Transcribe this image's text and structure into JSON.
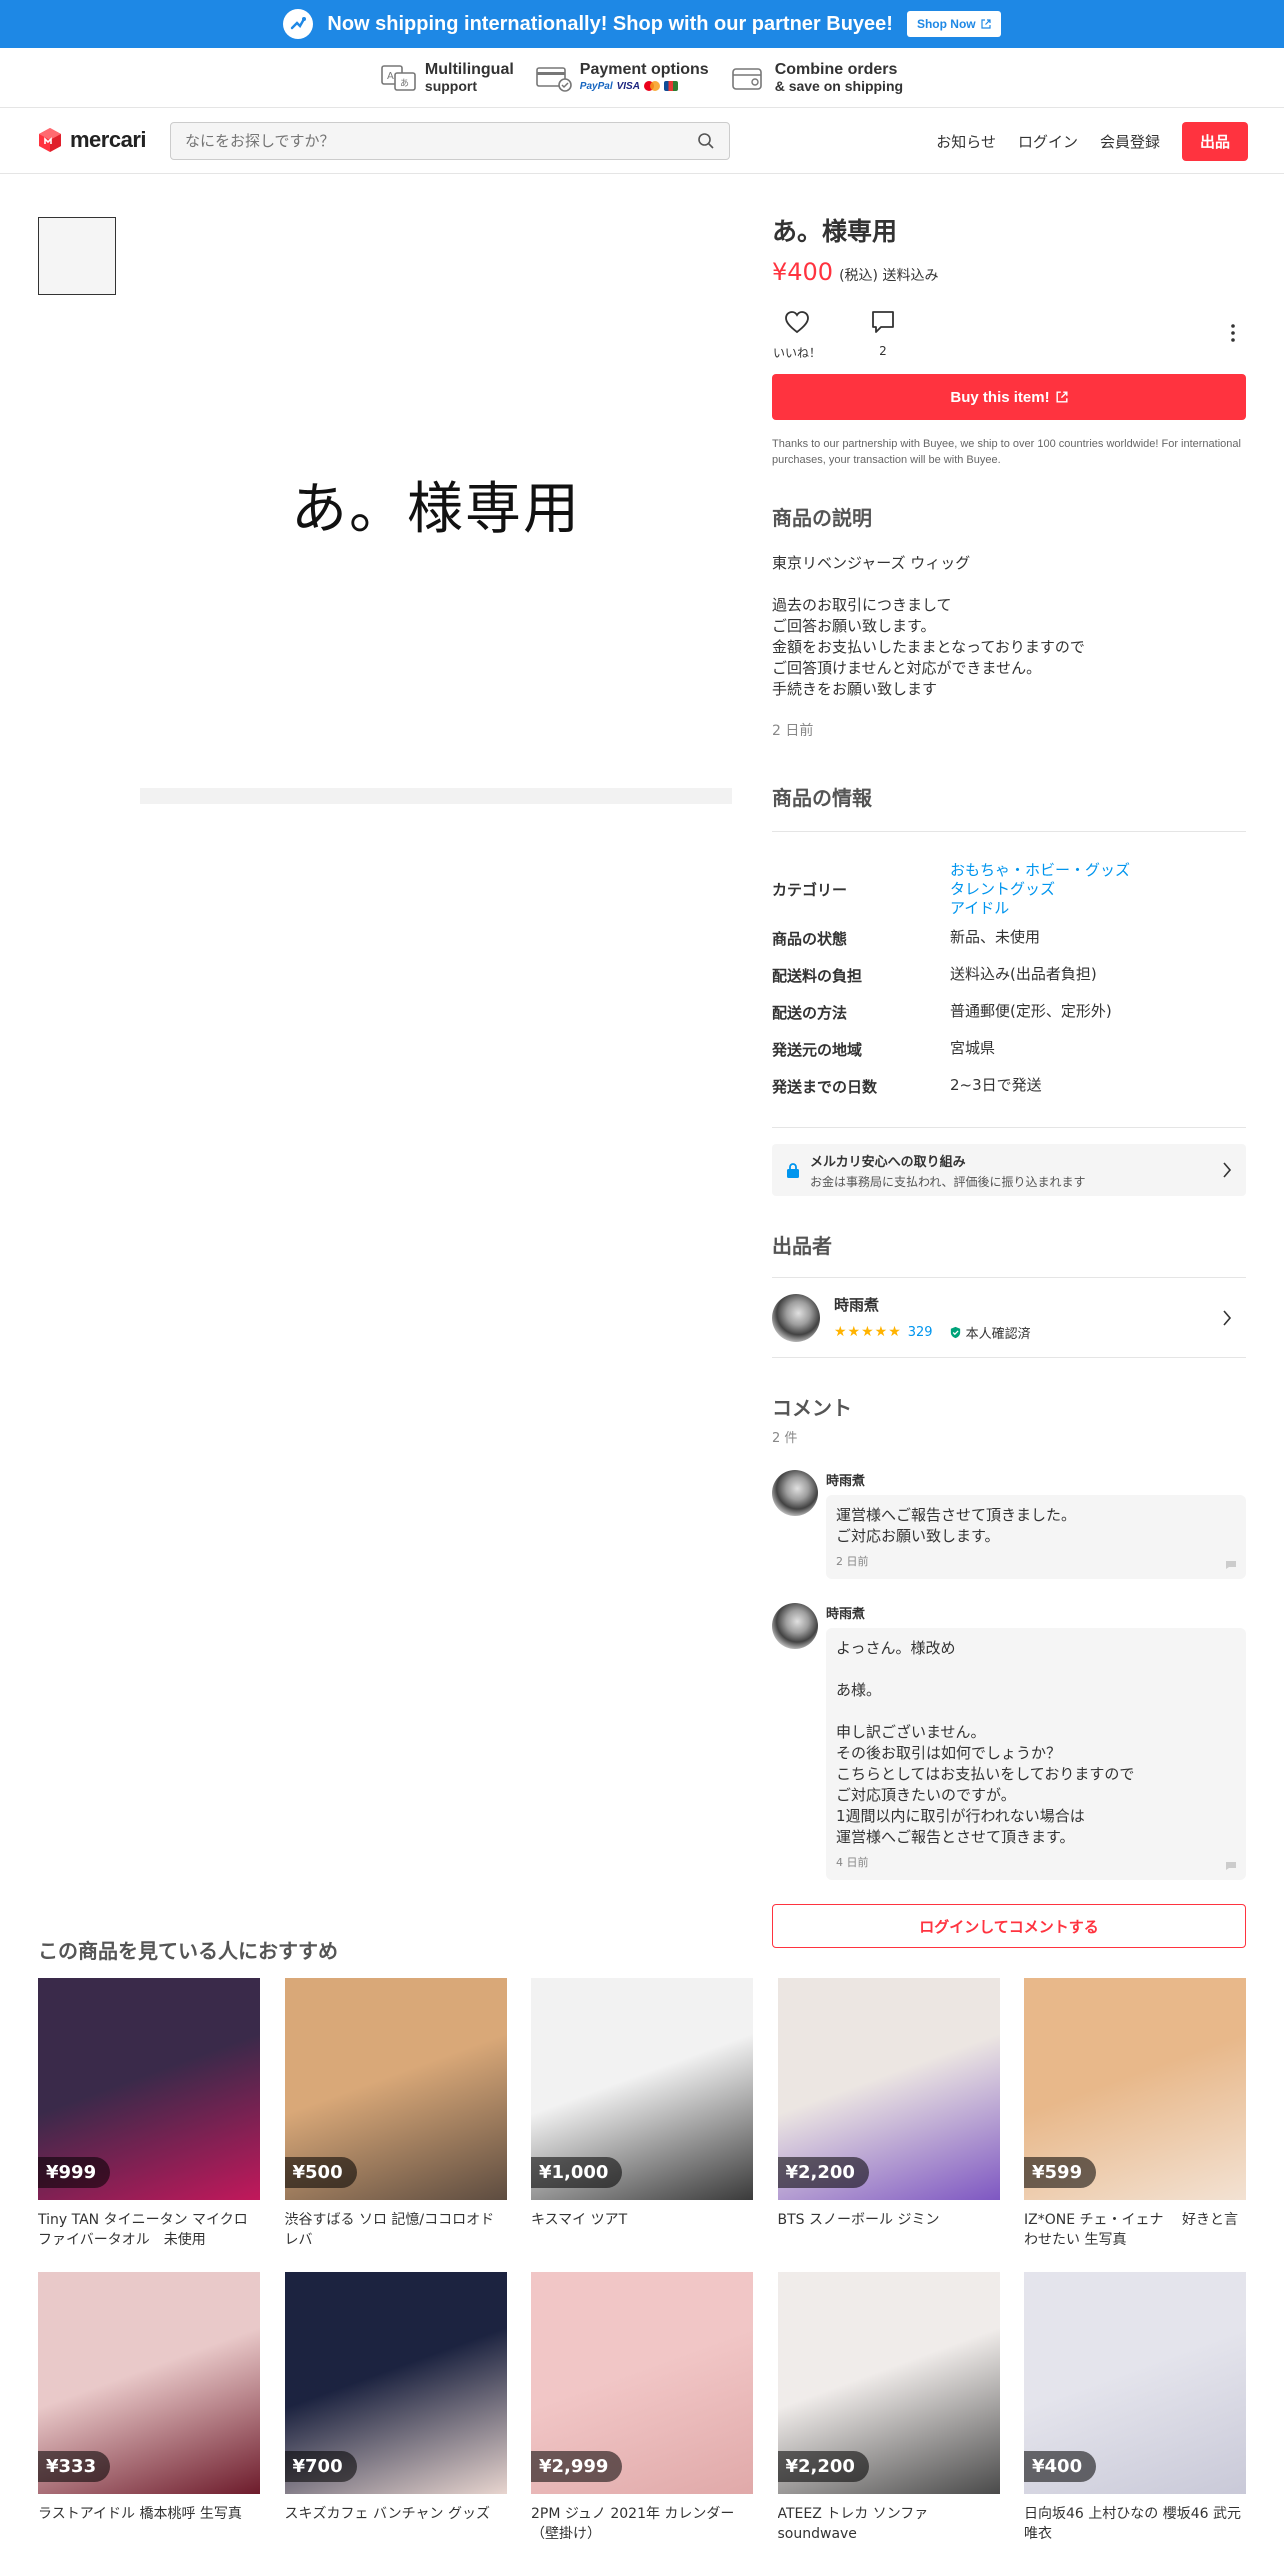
{
  "banner": {
    "text": "Now shipping internationally! Shop with our partner Buyee!",
    "button": "Shop Now"
  },
  "features": [
    {
      "icon": "translate-icon",
      "line1": "Multilingual",
      "line2": "support"
    },
    {
      "icon": "credit-card-icon",
      "line1": "Payment options",
      "logos": [
        "PayPal",
        "VISA"
      ]
    },
    {
      "icon": "box-icon",
      "line1": "Combine orders",
      "line2": "& save on shipping"
    }
  ],
  "header": {
    "logo": "mercari",
    "search_placeholder": "なにをお探しですか？",
    "nav": {
      "notifications": "お知らせ",
      "login": "ログイン",
      "signup": "会員登録",
      "sell": "出品"
    }
  },
  "product": {
    "image_text": "あ。様専用",
    "title": "あ。様専用",
    "price": "¥400",
    "price_note": "(税込) 送料込み",
    "like_label": "いいね！",
    "comment_count": "2",
    "buy_button": "Buy this item!",
    "buy_note": "Thanks to our partnership with Buyee, we ship to over 100 countries worldwide! For international purchases, your transaction will be with Buyee.",
    "description_title": "商品の説明",
    "description": "東京リベンジャーズ ウィッグ\n\n過去のお取引につきまして\nご回答お願い致します。\n金額をお支払いしたままとなっておりますので\nご回答頂けませんと対応ができません。\n手続きをお願い致します",
    "posted": "2 日前",
    "info_title": "商品の情報",
    "info": {
      "category_label": "カテゴリー",
      "categories": [
        "おもちゃ・ホビー・グッズ",
        "タレントグッズ",
        "アイドル"
      ],
      "rows": [
        {
          "key": "商品の状態",
          "value": "新品、未使用"
        },
        {
          "key": "配送料の負担",
          "value": "送料込み(出品者負担)"
        },
        {
          "key": "配送の方法",
          "value": "普通郵便(定形、定形外)"
        },
        {
          "key": "発送元の地域",
          "value": "宮城県"
        },
        {
          "key": "発送までの日数",
          "value": "2~3日で発送"
        }
      ]
    },
    "safety": {
      "title": "メルカリ安心への取り組み",
      "sub": "お金は事務局に支払われ、評価後に振り込まれます"
    }
  },
  "seller": {
    "section_title": "出品者",
    "name": "時雨煮",
    "rating_count": "329",
    "stars": 5,
    "verified": "本人確認済"
  },
  "comments": {
    "title": "コメント",
    "count": "2 件",
    "items": [
      {
        "name": "時雨煮",
        "text": "運営様へご報告させて頂きました。\nご対応お願い致します。",
        "time": "2 日前"
      },
      {
        "name": "時雨煮",
        "text": "よっさん。様改め\n\nあ様。\n\n申し訳ございません。\nその後お取引は如何でしょうか？\nこちらとしてはお支払いをしておりますので\nご対応頂きたいのですが。\n1週間以内に取引が行われない場合は\n運営様へご報告とさせて頂きます。",
        "time": "4 日前"
      }
    ],
    "login_button": "ログインしてコメントする"
  },
  "recommendations": {
    "title": "この商品を見ている人におすすめ",
    "items": [
      {
        "price": "¥999",
        "name": "Tiny TAN タイニータン マイクロファイバータオル　未使用",
        "colors": [
          "#3a2a4a",
          "#c2185b"
        ]
      },
      {
        "price": "¥500",
        "name": "渋谷すばる ソロ 記憶/ココロオドレバ",
        "colors": [
          "#d9a878",
          "#5d4c40"
        ]
      },
      {
        "price": "¥1,000",
        "name": "キスマイ ツアT",
        "colors": [
          "#f2f2f2",
          "#3a3a3a"
        ]
      },
      {
        "price": "¥2,200",
        "name": "BTS スノーボール ジミン",
        "colors": [
          "#ece6e2",
          "#7e57c2"
        ]
      },
      {
        "price": "¥599",
        "name": "IZ*ONE チェ・イェナ　 好きと言わせたい 生写真",
        "colors": [
          "#e8b88a",
          "#f3e2d3"
        ]
      },
      {
        "price": "¥333",
        "name": "ラストアイドル 橋本桃呼 生写真",
        "colors": [
          "#e9c9c9",
          "#6d1b2b"
        ]
      },
      {
        "price": "¥700",
        "name": "スキズカフェ バンチャン グッズ",
        "colors": [
          "#1c2340",
          "#e8d5cf"
        ]
      },
      {
        "price": "¥2,999",
        "name": "2PM ジュノ 2021年 カレンダー（壁掛け）",
        "colors": [
          "#f1c6c6",
          "#e0a9a9"
        ]
      },
      {
        "price": "¥2,200",
        "name": "ATEEZ トレカ ソンファ soundwave",
        "colors": [
          "#f0ecea",
          "#4a4a4a"
        ]
      },
      {
        "price": "¥400",
        "name": "日向坂46 上村ひなの 櫻坂46 武元唯衣",
        "colors": [
          "#e4e4ec",
          "#c9c9d8"
        ]
      }
    ]
  }
}
